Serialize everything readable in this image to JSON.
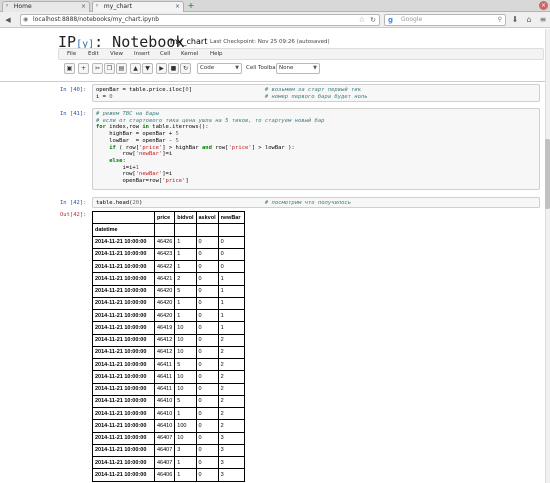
{
  "browser": {
    "tabs": [
      {
        "label": "Home",
        "favicon": "ipython-favicon"
      },
      {
        "label": "my_chart",
        "favicon": "ipython-favicon"
      }
    ],
    "new_tab": "+",
    "url": "localhost:8888/notebooks/my_chart.ipynb",
    "search_placeholder": "Google"
  },
  "notebook": {
    "logo_prefix": "IP",
    "logo_bracket": "[y]",
    "logo_suffix": ": Notebook",
    "title": "my_chart",
    "checkpoint": "Last Checkpoint: Nov 25 09:26 (autosaved)",
    "menu": [
      "File",
      "Edit",
      "View",
      "Insert",
      "Cell",
      "Kernel",
      "Help"
    ],
    "toolbar": {
      "cell_type": "Code",
      "cell_toolbar_label": "Cell Toolbar:",
      "cell_toolbar_value": "None"
    }
  },
  "cells": [
    {
      "prompt": "In [40]:"
    },
    {
      "prompt": "In [41]:"
    },
    {
      "prompt": "In [42]:"
    }
  ],
  "cell40": {
    "line1_code": "openBar = table.price.iloc[0]",
    "line1_comment": "# возьмем за старт первый тик",
    "line2_code": "i = 0",
    "line2_comment": "# номер первого бара будет ноль"
  },
  "cell41": {
    "c1": "# режем ТВС на бары",
    "c2": "# если от стартового тика цена ушла на 5 тиков, то стартуем новый бар",
    "l3": "for index,row in table.iterrows():",
    "l4": "    highBar = openBar + 5",
    "l5": "    lowBar  = openBar - 5",
    "l6": "    if ( row['price'] > highBar and row['price'] > lowBar ):",
    "l7": "        row['newBar']=i",
    "l8": "    else:",
    "l9": "        i=i+1",
    "l10": "        row['newBar']=i",
    "l11": "        openBar=row['price']"
  },
  "cell42": {
    "code": "table.head(20)",
    "comment": "# посмотрим что получилось"
  },
  "out42": {
    "prompt": "Out[42]:",
    "columns": [
      "",
      "price",
      "bidvol",
      "askvol",
      "newBar"
    ],
    "index_name": "datetime",
    "rows": [
      [
        "2014-11-21 10:00:00",
        "46426",
        "1",
        "0",
        "0"
      ],
      [
        "2014-11-21 10:00:00",
        "46423",
        "1",
        "0",
        "0"
      ],
      [
        "2014-11-21 10:00:00",
        "46422",
        "1",
        "0",
        "0"
      ],
      [
        "2014-11-21 10:00:00",
        "46421",
        "2",
        "0",
        "1"
      ],
      [
        "2014-11-21 10:00:00",
        "46420",
        "5",
        "0",
        "1"
      ],
      [
        "2014-11-21 10:00:00",
        "46420",
        "1",
        "0",
        "1"
      ],
      [
        "2014-11-21 10:00:00",
        "46420",
        "1",
        "0",
        "1"
      ],
      [
        "2014-11-21 10:00:00",
        "46419",
        "10",
        "0",
        "1"
      ],
      [
        "2014-11-21 10:00:00",
        "46412",
        "10",
        "0",
        "2"
      ],
      [
        "2014-11-21 10:00:00",
        "46412",
        "10",
        "0",
        "2"
      ],
      [
        "2014-11-21 10:00:00",
        "46411",
        "5",
        "0",
        "2"
      ],
      [
        "2014-11-21 10:00:00",
        "46411",
        "10",
        "0",
        "2"
      ],
      [
        "2014-11-21 10:00:00",
        "46411",
        "10",
        "0",
        "2"
      ],
      [
        "2014-11-21 10:00:00",
        "46410",
        "5",
        "0",
        "2"
      ],
      [
        "2014-11-21 10:00:00",
        "46410",
        "1",
        "0",
        "2"
      ],
      [
        "2014-11-21 10:00:00",
        "46410",
        "100",
        "0",
        "2"
      ],
      [
        "2014-11-21 10:00:00",
        "46407",
        "10",
        "0",
        "3"
      ],
      [
        "2014-11-21 10:00:00",
        "46407",
        "3",
        "0",
        "3"
      ],
      [
        "2014-11-21 10:00:00",
        "46407",
        "1",
        "0",
        "3"
      ],
      [
        "2014-11-21 10:00:00",
        "46406",
        "1",
        "0",
        "3"
      ]
    ]
  }
}
